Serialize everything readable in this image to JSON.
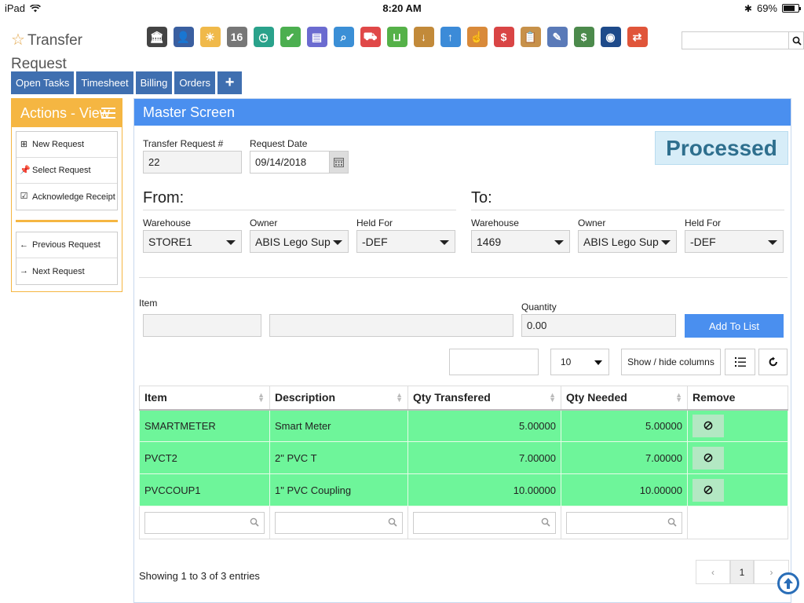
{
  "status_bar": {
    "device": "iPad",
    "time": "8:20 AM",
    "battery": "69%",
    "battery_level": 0.69
  },
  "page": {
    "title": "Transfer Request"
  },
  "toolbar_icons": [
    {
      "name": "bank-icon",
      "color": "#444",
      "glyph": "🏛"
    },
    {
      "name": "user-icon",
      "color": "#3a5fa0",
      "glyph": "👤"
    },
    {
      "name": "weather-icon",
      "color": "#f0b94a",
      "glyph": "☀"
    },
    {
      "name": "calendar-icon",
      "color": "#777",
      "glyph": "16"
    },
    {
      "name": "clock-icon",
      "color": "#2aa28b",
      "glyph": "◷"
    },
    {
      "name": "checkmark-icon",
      "color": "#4caf50",
      "glyph": "✔"
    },
    {
      "name": "register-icon",
      "color": "#6b6bd0",
      "glyph": "▤"
    },
    {
      "name": "search-icon",
      "color": "#3b8fd6",
      "glyph": "⌕"
    },
    {
      "name": "truck-icon",
      "color": "#e04848",
      "glyph": "⛟"
    },
    {
      "name": "basket-icon",
      "color": "#55b148",
      "glyph": "⊔"
    },
    {
      "name": "inbox-download-icon",
      "color": "#c28a3a",
      "glyph": "↓"
    },
    {
      "name": "inbox-upload-icon",
      "color": "#3c8bd8",
      "glyph": "↑"
    },
    {
      "name": "hand-icon",
      "color": "#d98a3a",
      "glyph": "☝"
    },
    {
      "name": "dollar-speech-icon",
      "color": "#d94545",
      "glyph": "$"
    },
    {
      "name": "clipboard-icon",
      "color": "#c7914a",
      "glyph": "📋"
    },
    {
      "name": "pencil-paper-icon",
      "color": "#5a7ab8",
      "glyph": "✎"
    },
    {
      "name": "money-icon",
      "color": "#4c8a4c",
      "glyph": "$"
    },
    {
      "name": "book-globe-icon",
      "color": "#1e4a8a",
      "glyph": "◉"
    },
    {
      "name": "swap-icon",
      "color": "#e0553a",
      "glyph": "⇄"
    }
  ],
  "top_search": {
    "value": ""
  },
  "nav": {
    "open_tasks": "Open Tasks",
    "timesheet": "Timesheet",
    "billing": "Billing",
    "orders": "Orders",
    "plus": "+"
  },
  "actions": {
    "title": "Actions - View",
    "items": [
      "New Request",
      "Select Request",
      "Acknowledge Receipt"
    ],
    "nav_items": [
      "Previous Request",
      "Next Request"
    ]
  },
  "master": {
    "title": "Master Screen",
    "status": "Processed",
    "transfer_request_label": "Transfer Request #",
    "transfer_request_value": "22",
    "request_date_label": "Request Date",
    "request_date_value": "09/14/2018",
    "from": {
      "title": "From:",
      "warehouse_label": "Warehouse",
      "warehouse": "STORE1",
      "owner_label": "Owner",
      "owner": "ABIS Lego Sup",
      "held_for_label": "Held For",
      "held_for": "-DEF"
    },
    "to": {
      "title": "To:",
      "warehouse_label": "Warehouse",
      "warehouse": "1469",
      "owner_label": "Owner",
      "owner": "ABIS Lego Sup",
      "held_for_label": "Held For",
      "held_for": "-DEF"
    },
    "item_label": "Item",
    "item_code": "",
    "item_desc": "",
    "quantity_label": "Quantity",
    "quantity_value": "0.00",
    "add_to_list": "Add To List",
    "table_search": "",
    "page_size": "10",
    "show_hide_columns": "Show / hide columns"
  },
  "table": {
    "columns": [
      "Item",
      "Description",
      "Qty Transfered",
      "Qty Needed",
      "Remove"
    ],
    "rows": [
      {
        "item": "SMARTMETER",
        "description": "Smart Meter",
        "qty_transfered": "5.00000",
        "qty_needed": "5.00000"
      },
      {
        "item": "PVCT2",
        "description": "2\" PVC T",
        "qty_transfered": "7.00000",
        "qty_needed": "7.00000"
      },
      {
        "item": "PVCCOUP1",
        "description": "1\" PVC Coupling",
        "qty_transfered": "10.00000",
        "qty_needed": "10.00000"
      }
    ],
    "showing": "Showing 1 to 3 of 3 entries",
    "pager": {
      "prev": "‹",
      "page": "1",
      "next": "›"
    }
  },
  "colors": {
    "nav_blue": "#3f6fb0",
    "accent_blue": "#4a8fef",
    "actions_orange": "#f5b642",
    "row_green": "#6ef59a",
    "status_text": "#2e6f8e"
  }
}
